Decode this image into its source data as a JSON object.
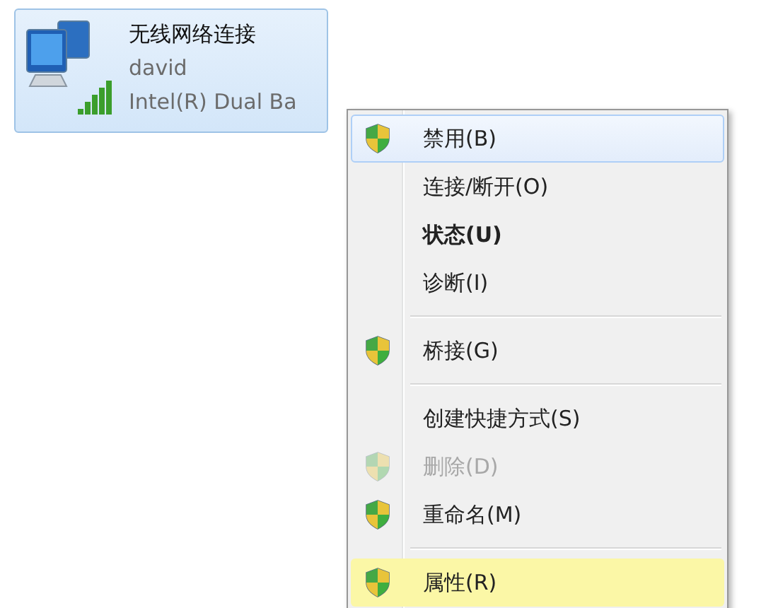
{
  "adapter": {
    "name": "无线网络连接",
    "network": "david",
    "device": "Intel(R) Dual Ba"
  },
  "context_menu": {
    "items": [
      {
        "kind": "item",
        "label": "禁用(B)",
        "shield": true,
        "bold": false,
        "disabled": false,
        "selected": true,
        "highlighted": false
      },
      {
        "kind": "item",
        "label": "连接/断开(O)",
        "shield": false,
        "bold": false,
        "disabled": false,
        "selected": false,
        "highlighted": false
      },
      {
        "kind": "item",
        "label": "状态(U)",
        "shield": false,
        "bold": true,
        "disabled": false,
        "selected": false,
        "highlighted": false
      },
      {
        "kind": "item",
        "label": "诊断(I)",
        "shield": false,
        "bold": false,
        "disabled": false,
        "selected": false,
        "highlighted": false
      },
      {
        "kind": "separator"
      },
      {
        "kind": "item",
        "label": "桥接(G)",
        "shield": true,
        "bold": false,
        "disabled": false,
        "selected": false,
        "highlighted": false
      },
      {
        "kind": "separator"
      },
      {
        "kind": "item",
        "label": "创建快捷方式(S)",
        "shield": false,
        "bold": false,
        "disabled": false,
        "selected": false,
        "highlighted": false
      },
      {
        "kind": "item",
        "label": "删除(D)",
        "shield": true,
        "bold": false,
        "disabled": true,
        "selected": false,
        "highlighted": false
      },
      {
        "kind": "item",
        "label": "重命名(M)",
        "shield": true,
        "bold": false,
        "disabled": false,
        "selected": false,
        "highlighted": false
      },
      {
        "kind": "separator"
      },
      {
        "kind": "item",
        "label": "属性(R)",
        "shield": true,
        "bold": false,
        "disabled": false,
        "selected": false,
        "highlighted": true
      }
    ]
  }
}
